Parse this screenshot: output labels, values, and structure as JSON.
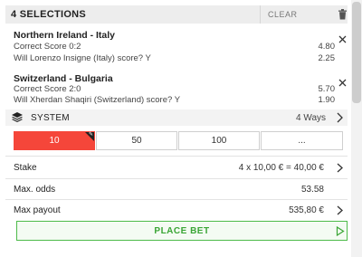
{
  "betslip": {
    "header": {
      "title": "4 SELECTIONS",
      "clear_label": "CLEAR",
      "icon": "trash-icon"
    },
    "selections": [
      {
        "match": "Northern Ireland - Italy",
        "picks": [
          {
            "label": "Correct Score 0:2",
            "odds": "4.80"
          },
          {
            "label": "Will Lorenzo Insigne (Italy) score? Y",
            "odds": "2.25"
          }
        ],
        "remove_icon": "close-icon"
      },
      {
        "match": "Switzerland - Bulgaria",
        "picks": [
          {
            "label": "Correct Score 2:0",
            "odds": "5.70"
          },
          {
            "label": "Will Xherdan Shaqiri (Switzerland) score? Y",
            "odds": "1.90"
          }
        ],
        "remove_icon": "close-icon"
      }
    ],
    "system": {
      "label": "SYSTEM",
      "ways": "4 Ways",
      "icon": "layers-icon"
    },
    "stake_options": [
      {
        "label": "10",
        "active": true
      },
      {
        "label": "50",
        "active": false
      },
      {
        "label": "100",
        "active": false
      },
      {
        "label": "...",
        "active": false
      }
    ],
    "stake": {
      "label": "Stake",
      "value": "4 x 10,00 € = 40,00 €"
    },
    "max_odds": {
      "label": "Max. odds",
      "value": "53.58"
    },
    "max_payout": {
      "label": "Max payout",
      "value": "535,80 €"
    },
    "place_bet_label": "PLACE BET",
    "colors": {
      "accent_red": "#f5463a",
      "accent_green": "#3aa535",
      "header_bg": "#ededed"
    }
  }
}
